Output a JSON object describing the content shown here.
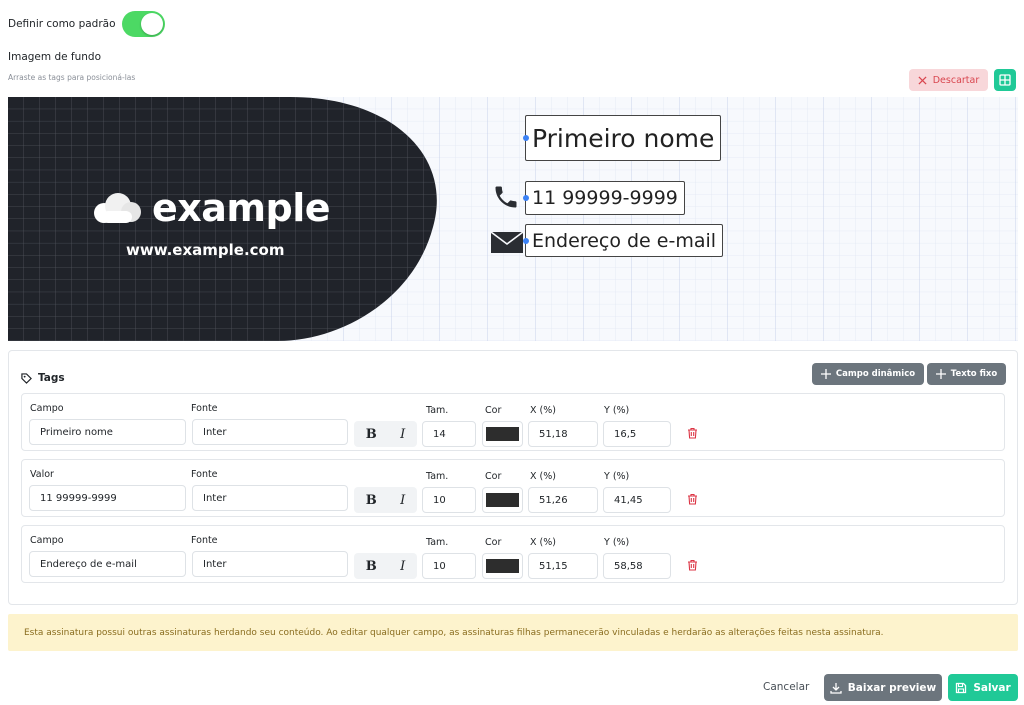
{
  "settings": {
    "default_label": "Definir como padrão",
    "default_enabled": true
  },
  "background": {
    "title": "Imagem de fundo",
    "hint": "Arraste as tags para posicioná-las",
    "discard_label": "Descartar",
    "grid_toggle_icon": "grid-icon"
  },
  "preview": {
    "brand_word": "example",
    "brand_url": "www.example.com",
    "tag_name": "Primeiro nome",
    "tag_phone": "11 99999-9999",
    "tag_email": "Endereço de e-mail",
    "icons": [
      "cloud-icon",
      "phone-icon",
      "mail-icon"
    ]
  },
  "tags": {
    "title": "Tags",
    "add_dynamic_label": "Campo dinâmico",
    "add_fixed_label": "Texto fixo",
    "column_labels": {
      "font": "Fonte",
      "size": "Tam.",
      "color": "Cor",
      "x": "X (%)",
      "y": "Y (%)"
    },
    "rows": [
      {
        "first_label": "Campo",
        "value": "Primeiro nome",
        "font": "Inter",
        "size": "14",
        "color": "#2d2d2d",
        "x": "51,18",
        "y": "16,5"
      },
      {
        "first_label": "Valor",
        "value": "11 99999-9999",
        "font": "Inter",
        "size": "10",
        "color": "#2d2d2d",
        "x": "51,26",
        "y": "41,45"
      },
      {
        "first_label": "Campo",
        "value": "Endereço de e-mail",
        "font": "Inter",
        "size": "10",
        "color": "#2d2d2d",
        "x": "51,15",
        "y": "58,58"
      }
    ],
    "bold_glyph": "B",
    "italic_glyph": "I"
  },
  "notice": "Esta assinatura possui outras assinaturas herdando seu conteúdo. Ao editar qualquer campo, as assinaturas filhas permanecerão vinculadas e herdarão as alterações feitas nesta assinatura.",
  "footer": {
    "cancel_label": "Cancelar",
    "preview_label": "Baixar preview",
    "save_label": "Salvar"
  },
  "colors": {
    "accent_green": "#20c997",
    "toggle_green": "#4cd964",
    "discard_bg": "#f8d7da",
    "discard_text": "#d9464f",
    "secondary": "#6c757d",
    "notice_bg": "#fdf3cd",
    "dark_shape": "#20232a"
  }
}
